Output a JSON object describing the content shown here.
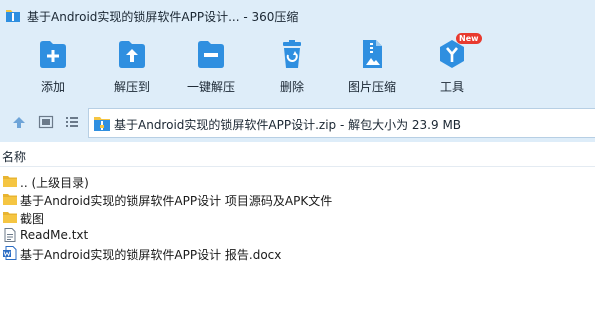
{
  "window": {
    "title": "基于Android实现的锁屏软件APP设计... - 360压缩"
  },
  "toolbar": {
    "items": [
      {
        "label": "添加",
        "icon": "add-icon"
      },
      {
        "label": "解压到",
        "icon": "extract-to-icon"
      },
      {
        "label": "一键解压",
        "icon": "one-click-extract-icon"
      },
      {
        "label": "删除",
        "icon": "delete-icon"
      },
      {
        "label": "图片压缩",
        "icon": "image-compress-icon"
      },
      {
        "label": "工具",
        "icon": "tools-icon",
        "badge": "New"
      }
    ]
  },
  "pathbar": {
    "path": "基于Android实现的锁屏软件APP设计.zip - 解包大小为 23.9 MB"
  },
  "filelist": {
    "column_header": "名称",
    "rows": [
      {
        "name": ".. (上级目录)",
        "type": "folder-up"
      },
      {
        "name": "基于Android实现的锁屏软件APP设计 项目源码及APK文件",
        "type": "folder"
      },
      {
        "name": "截图",
        "type": "folder"
      },
      {
        "name": "ReadMe.txt",
        "type": "text-file"
      },
      {
        "name": "基于Android实现的锁屏软件APP设计 报告.docx",
        "type": "word-file"
      }
    ]
  },
  "colors": {
    "chrome_bg": "#deedf9",
    "icon_blue": "#2f8fe0",
    "badge_red": "#e83a2f",
    "folder_yellow": "#f5c542"
  }
}
